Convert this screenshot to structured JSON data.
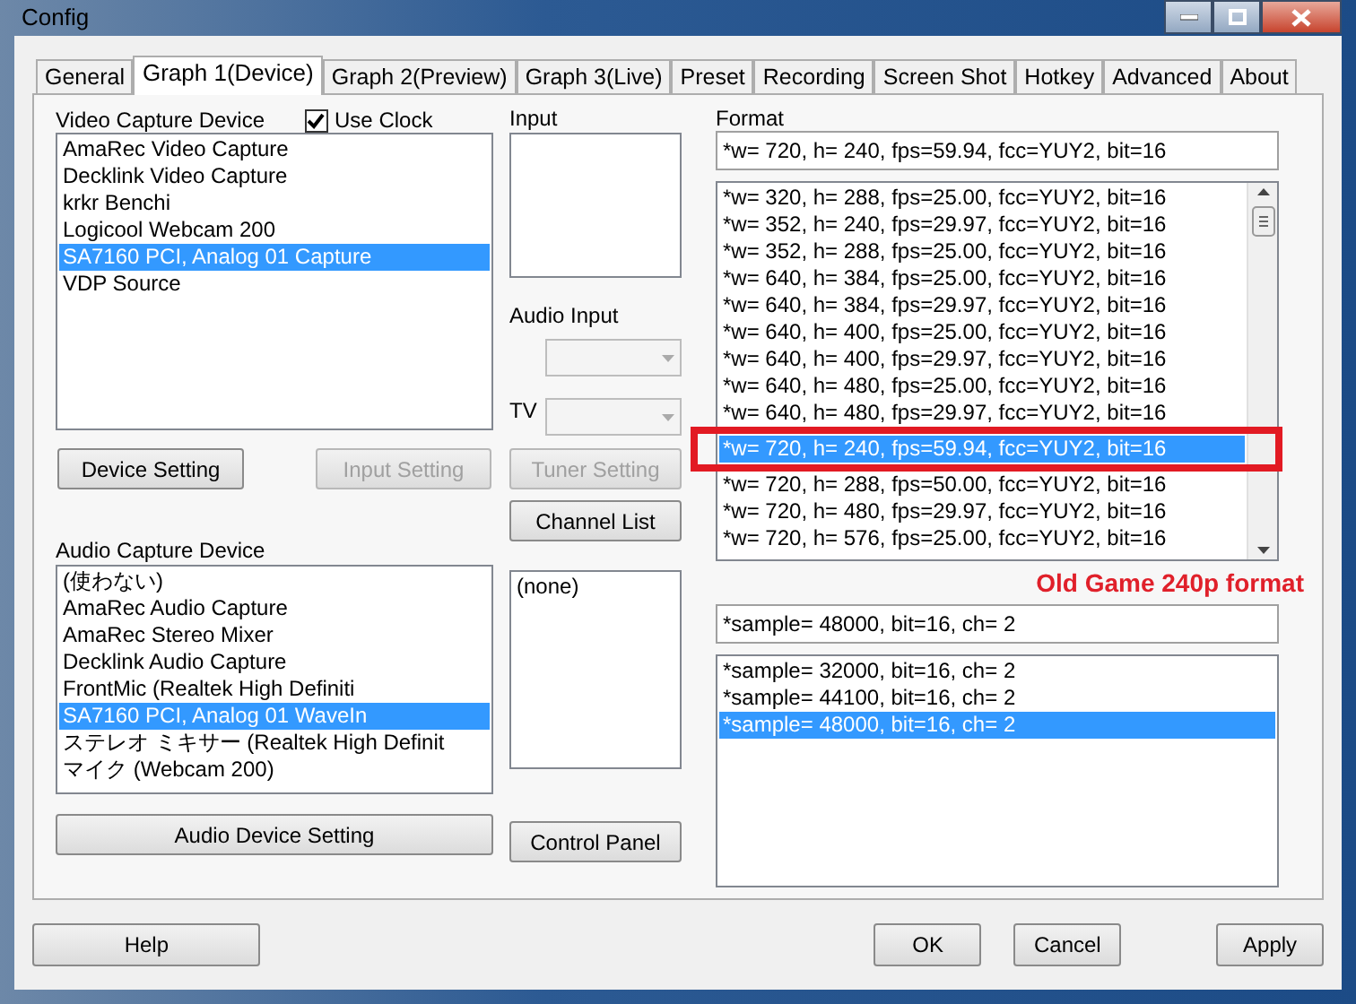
{
  "window": {
    "title": "Config"
  },
  "tabs": [
    {
      "label": "General",
      "selected": false
    },
    {
      "label": "Graph 1(Device)",
      "selected": true
    },
    {
      "label": "Graph 2(Preview)",
      "selected": false
    },
    {
      "label": "Graph 3(Live)",
      "selected": false
    },
    {
      "label": "Preset",
      "selected": false
    },
    {
      "label": "Recording",
      "selected": false
    },
    {
      "label": "Screen Shot",
      "selected": false
    },
    {
      "label": "Hotkey",
      "selected": false
    },
    {
      "label": "Advanced",
      "selected": false
    },
    {
      "label": "About",
      "selected": false
    }
  ],
  "video_capture": {
    "label": "Video Capture Device",
    "use_clock": {
      "label": "Use Clock",
      "checked": true
    },
    "items": [
      {
        "text": "AmaRec Video Capture",
        "selected": false
      },
      {
        "text": "Decklink Video Capture",
        "selected": false
      },
      {
        "text": "krkr Benchi",
        "selected": false
      },
      {
        "text": "Logicool Webcam 200",
        "selected": false
      },
      {
        "text": "SA7160 PCI, Analog 01 Capture",
        "selected": true
      },
      {
        "text": "VDP Source",
        "selected": false
      }
    ],
    "buttons": [
      {
        "label": "Device Setting",
        "disabled": false
      },
      {
        "label": "Input Setting",
        "disabled": true
      }
    ]
  },
  "input": {
    "label": "Input",
    "audio_input_label": "Audio Input",
    "tv_label": "TV",
    "buttons": [
      {
        "label": "Tuner Setting",
        "disabled": true
      },
      {
        "label": "Channel List",
        "disabled": false
      }
    ]
  },
  "format": {
    "label": "Format",
    "value": "*w= 720, h= 240, fps=59.94,  fcc=YUY2, bit=16",
    "items": [
      {
        "text": "*w= 320, h= 288, fps=25.00,  fcc=YUY2, bit=16",
        "selected": false
      },
      {
        "text": "*w= 352, h= 240, fps=29.97,  fcc=YUY2, bit=16",
        "selected": false
      },
      {
        "text": "*w= 352, h= 288, fps=25.00,  fcc=YUY2, bit=16",
        "selected": false
      },
      {
        "text": "*w= 640, h= 384, fps=25.00,  fcc=YUY2, bit=16",
        "selected": false
      },
      {
        "text": "*w= 640, h= 384, fps=29.97,  fcc=YUY2, bit=16",
        "selected": false
      },
      {
        "text": "*w= 640, h= 400, fps=25.00,  fcc=YUY2, bit=16",
        "selected": false
      },
      {
        "text": "*w= 640, h= 400, fps=29.97,  fcc=YUY2, bit=16",
        "selected": false
      },
      {
        "text": "*w= 640, h= 480, fps=25.00,  fcc=YUY2, bit=16",
        "selected": false
      },
      {
        "text": "*w= 640, h= 480, fps=29.97,  fcc=YUY2, bit=16",
        "selected": false
      },
      {
        "text": "*w= 720, h= 240, fps=59.94,  fcc=YUY2, bit=16",
        "selected": true
      },
      {
        "text": "*w= 720, h= 288, fps=50.00,  fcc=YUY2, bit=16",
        "selected": false
      },
      {
        "text": "*w= 720, h= 480, fps=29.97,  fcc=YUY2, bit=16",
        "selected": false
      },
      {
        "text": "*w= 720, h= 576, fps=25.00,  fcc=YUY2, bit=16",
        "selected": false
      }
    ]
  },
  "annotation": {
    "text": "Old Game 240p format"
  },
  "audio_capture": {
    "label": "Audio Capture Device",
    "items": [
      {
        "text": "(使わない)",
        "selected": false
      },
      {
        "text": "AmaRec Audio Capture",
        "selected": false
      },
      {
        "text": "AmaRec Stereo Mixer",
        "selected": false
      },
      {
        "text": "Decklink Audio Capture",
        "selected": false
      },
      {
        "text": "FrontMic (Realtek High Definiti",
        "selected": false
      },
      {
        "text": "SA7160 PCI, Analog 01 WaveIn",
        "selected": true
      },
      {
        "text": "ステレオ ミキサー (Realtek High Definit",
        "selected": false
      },
      {
        "text": "マイク (Webcam 200)",
        "selected": false
      }
    ],
    "button": "Audio Device Setting"
  },
  "audio_input_list": {
    "items": [
      {
        "text": "(none)",
        "selected": false
      }
    ],
    "button": "Control Panel"
  },
  "audio_format": {
    "value": "*sample= 48000, bit=16, ch= 2",
    "items": [
      {
        "text": "*sample= 32000, bit=16, ch= 2",
        "selected": false
      },
      {
        "text": "*sample= 44100, bit=16, ch= 2",
        "selected": false
      },
      {
        "text": "*sample= 48000, bit=16, ch= 2",
        "selected": true
      }
    ]
  },
  "buttons": [
    "Help",
    "OK",
    "Cancel",
    "Apply"
  ]
}
